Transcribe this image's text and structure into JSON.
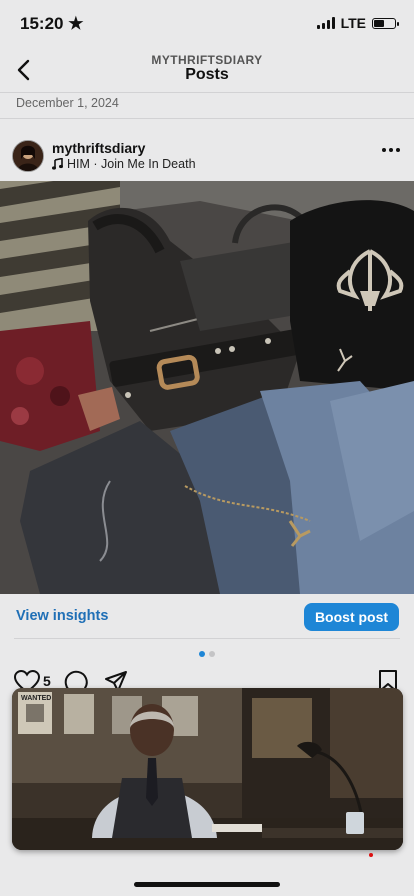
{
  "status_bar": {
    "time": "15:20",
    "network": "LTE",
    "battery_level": 0.45
  },
  "header": {
    "account": "MYTHRIFTSDIARY",
    "title": "Posts"
  },
  "date": "December 1, 2024",
  "post": {
    "username": "mythriftsdiary",
    "music": "HIM · Join Me In Death",
    "like_count": "5",
    "carousel_index": 1,
    "carousel_total": 2
  },
  "insights": {
    "view_label": "View insights",
    "boost_label": "Boost post"
  },
  "colors": {
    "link": "#1f6fb6",
    "boost_bg": "#1e86d6",
    "active_dot": "#1e86d6",
    "inactive_dot": "#c4c4c6"
  },
  "video_overlay": {
    "poster_text": "WANTED"
  }
}
